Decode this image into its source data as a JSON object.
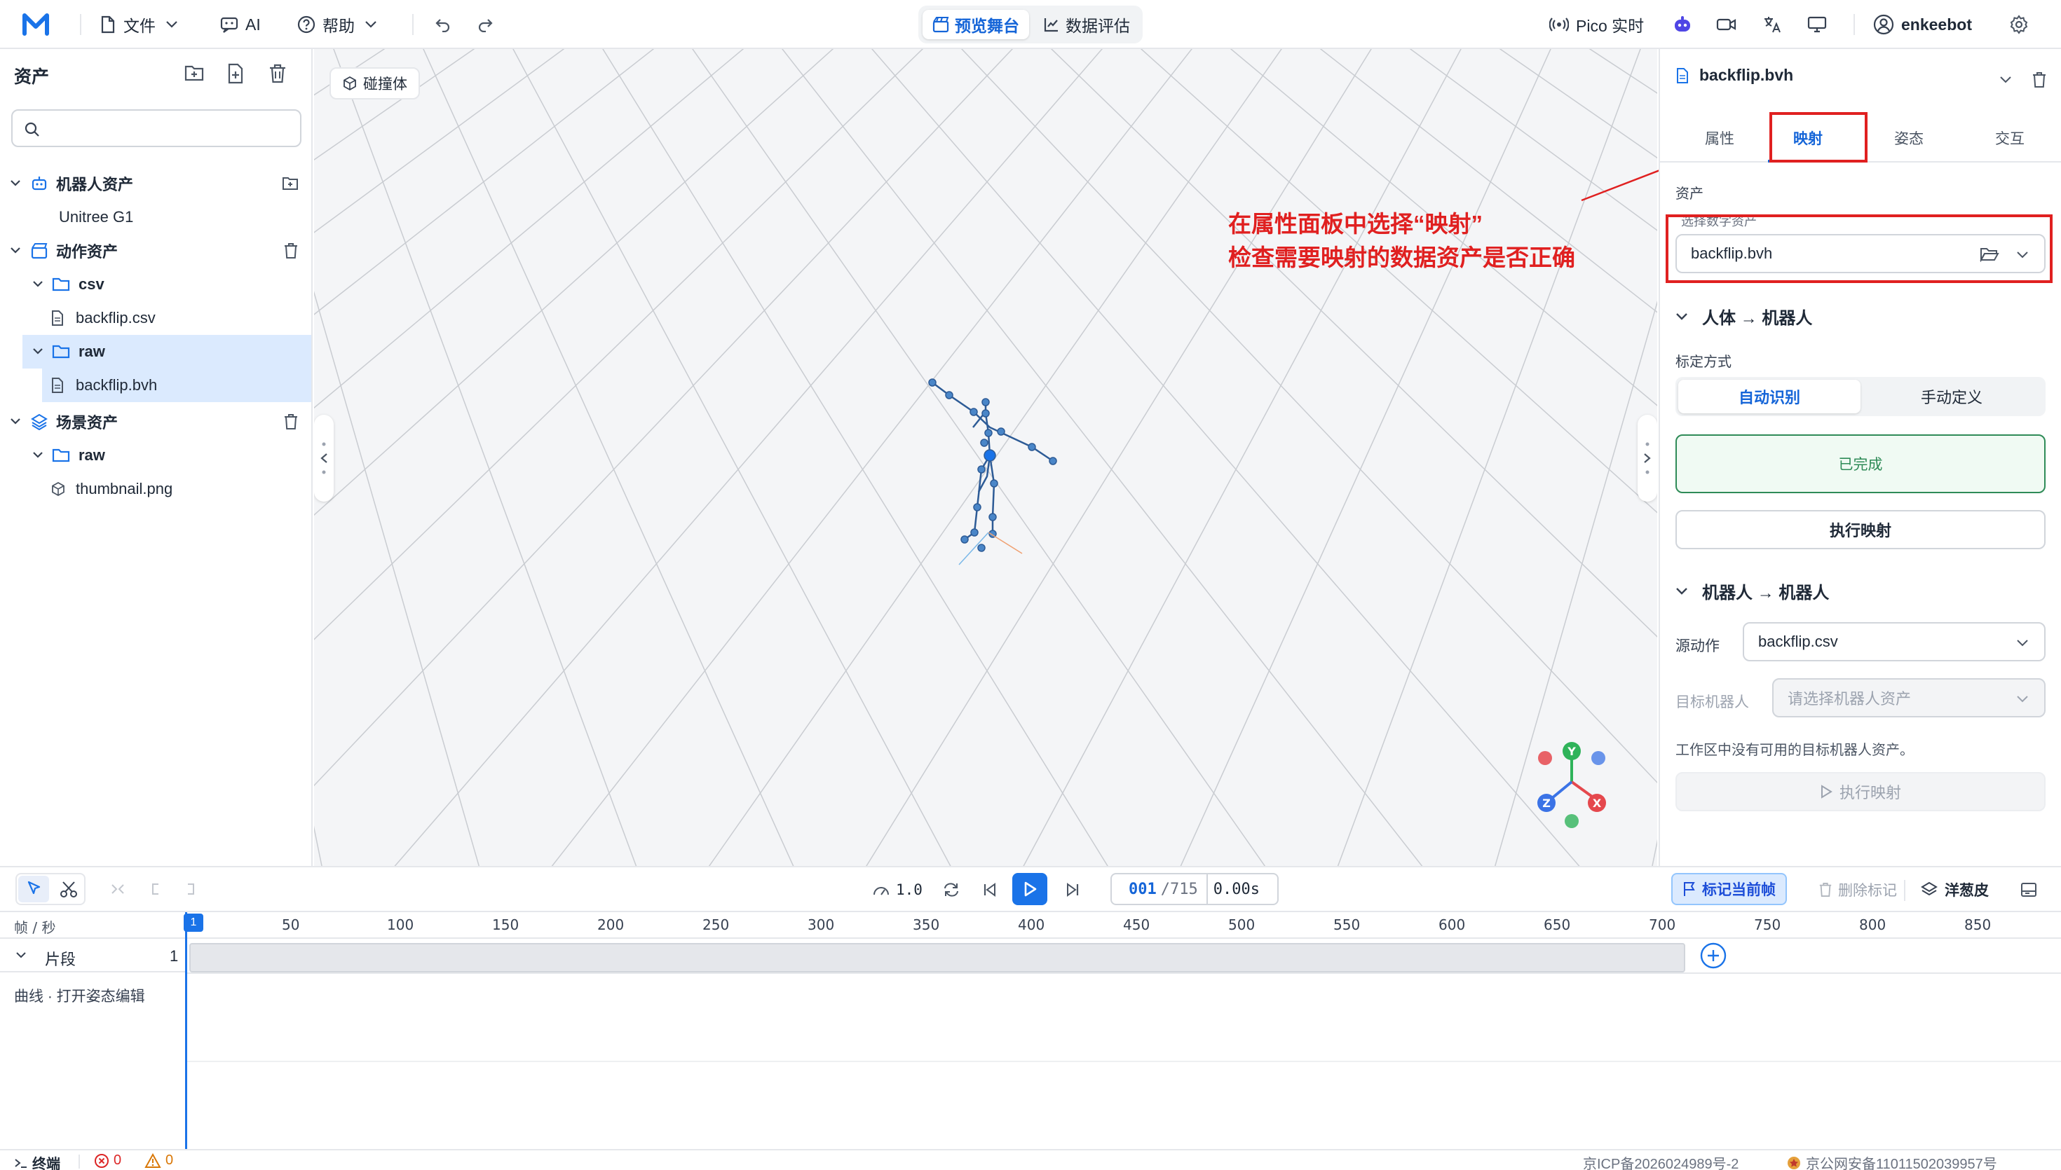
{
  "app": {
    "logo_letter": "M",
    "menu": {
      "file": "文件",
      "ai": "AI",
      "help": "帮助"
    },
    "center_tabs": [
      {
        "label": "预览舞台",
        "active": true
      },
      {
        "label": "数据评估",
        "active": false
      }
    ],
    "right_menu": {
      "pico": "Pico 实时",
      "user": "enkeebot"
    }
  },
  "left_panel": {
    "title": "资产",
    "search": {
      "value": "",
      "placeholder": ""
    },
    "tree": [
      {
        "label": "机器人资产",
        "level": 0,
        "kind": "robot-group",
        "bold": true,
        "action": "folder-add"
      },
      {
        "label": "Unitree G1",
        "level": 1,
        "kind": "robot"
      },
      {
        "label": "动作资产",
        "level": 0,
        "kind": "motion-group",
        "bold": true,
        "action": "trash"
      },
      {
        "label": "csv",
        "level": 1,
        "kind": "folder",
        "bold": true
      },
      {
        "label": "backflip.csv",
        "level": 2,
        "kind": "file"
      },
      {
        "label": "raw",
        "level": 1,
        "kind": "folder",
        "bold": true,
        "selected": true
      },
      {
        "label": "backflip.bvh",
        "level": 2,
        "kind": "file",
        "selected": true
      },
      {
        "label": "场景资产",
        "level": 0,
        "kind": "scene-group",
        "bold": true,
        "action": "trash"
      },
      {
        "label": "raw",
        "level": 1,
        "kind": "folder",
        "bold": true
      },
      {
        "label": "thumbnail.png",
        "level": 2,
        "kind": "cube"
      }
    ]
  },
  "viewport": {
    "collider_button": "碰撞体",
    "annotation": {
      "line1": "在属性面板中选择“映射”",
      "line2": "检查需要映射的数据资产是否正确"
    },
    "gizmo": {
      "x": "X",
      "y": "Y",
      "z": "Z"
    },
    "colors": {
      "x": "#e5484d",
      "y": "#2fb35a",
      "z": "#3b73e6"
    }
  },
  "right_panel": {
    "file_name": "backflip.bvh",
    "tabs": [
      {
        "label": "属性"
      },
      {
        "label": "映射",
        "active": true
      },
      {
        "label": "姿态"
      },
      {
        "label": "交互"
      }
    ],
    "asset_section": "资产",
    "select_label": "选择数字资产",
    "select_value": "backflip.bvh",
    "human_to_robot": {
      "title": "人体 → 机器人",
      "calib_label": "标定方式",
      "calib_options": [
        "自动识别",
        "手动定义"
      ],
      "calib_selected": "自动识别",
      "status": "已完成",
      "run_button": "执行映射"
    },
    "robot_to_robot": {
      "title": "机器人 → 机器人",
      "source_label": "源动作",
      "source_value": "backflip.csv",
      "target_label": "目标机器人",
      "target_placeholder": "请选择机器人资产",
      "hint": "工作区中没有可用的目标机器人资产。",
      "run_button": "执行映射"
    }
  },
  "timeline": {
    "speed": "1.0",
    "frame_current": "001",
    "frame_total": "/715",
    "time": "0.00s",
    "mark_button": "标记当前帧",
    "delete_mark_button": "删除标记",
    "onion_button": "洋葱皮",
    "ruler_label": "帧 / 秒",
    "ticks": [
      "50",
      "100",
      "150",
      "200",
      "250",
      "300",
      "350",
      "400",
      "450",
      "500",
      "550",
      "600",
      "650",
      "700",
      "750",
      "800",
      "850"
    ],
    "playhead_label": "1",
    "segment_label": "片段",
    "segment_count": "1",
    "curve_label": "曲线 · 打开姿态编辑"
  },
  "statusbar": {
    "terminal": "终端",
    "errors": "0",
    "warnings": "0",
    "icp": "京ICP备2026024989号-2",
    "police": "京公网安备11011502039957号"
  },
  "colors": {
    "accent": "#1565d8",
    "annotation": "#e02020",
    "success": "#2e8b57"
  }
}
